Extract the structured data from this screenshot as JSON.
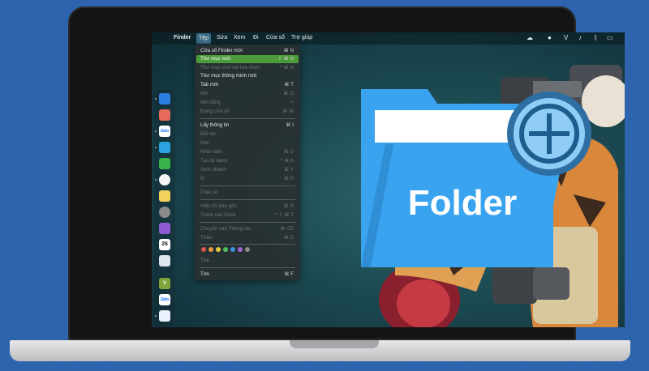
{
  "menubar": {
    "app": "Finder",
    "menus": [
      "Tệp",
      "Sửa",
      "Xem",
      "Đi",
      "Cửa sổ",
      "Trợ giúp"
    ]
  },
  "file_menu": {
    "items": [
      {
        "label": "Cửa sổ Finder mới",
        "shortcut": "⌘ N",
        "state": "normal"
      },
      {
        "label": "Thư mục mới",
        "shortcut": "⇧ ⌘ N",
        "state": "highlighted"
      },
      {
        "label": "Thư mục mới với lựa chọn",
        "shortcut": "^ ⌘ N",
        "state": "disabled"
      },
      {
        "label": "Thư mục thông minh mới",
        "shortcut": "",
        "state": "normal"
      },
      {
        "label": "Tab mới",
        "shortcut": "⌘ T",
        "state": "normal"
      },
      {
        "label": "Mở",
        "shortcut": "⌘ O",
        "state": "disabled"
      },
      {
        "label": "Mở bằng",
        "shortcut": ">",
        "state": "disabled"
      },
      {
        "label": "Đóng cửa sổ",
        "shortcut": "⌘ W",
        "state": "disabled"
      },
      {
        "label": "Lấy thông tin",
        "shortcut": "⌘ I",
        "state": "normal"
      },
      {
        "label": "Đổi tên",
        "shortcut": "",
        "state": "disabled"
      },
      {
        "label": "Nén",
        "shortcut": "",
        "state": "disabled"
      },
      {
        "label": "Nhân bản",
        "shortcut": "⌘ D",
        "state": "disabled"
      },
      {
        "label": "Tạo bí danh",
        "shortcut": "^ ⌘ A",
        "state": "disabled"
      },
      {
        "label": "Xem nhanh",
        "shortcut": "⌘ Y",
        "state": "disabled"
      },
      {
        "label": "In",
        "shortcut": "⌘ P",
        "state": "disabled"
      },
      {
        "label": "Chia sẻ",
        "shortcut": "",
        "state": "disabled"
      },
      {
        "label": "Hiển thị bản gốc",
        "shortcut": "⌘ R",
        "state": "disabled"
      },
      {
        "label": "Thêm vào Dock",
        "shortcut": "^ ⇧ ⌘ T",
        "state": "disabled"
      },
      {
        "label": "Chuyển vào Thùng rác",
        "shortcut": "⌘ ⌫",
        "state": "disabled"
      },
      {
        "label": "Tháo",
        "shortcut": "⌘ E",
        "state": "disabled"
      },
      {
        "label": "Thẻ...",
        "shortcut": "",
        "state": "disabled"
      },
      {
        "label": "Tìm",
        "shortcut": "⌘ F",
        "state": "normal"
      }
    ],
    "tag_colors": [
      "#e05252",
      "#e89a3c",
      "#e3c93b",
      "#4fbf5a",
      "#3f8fe0",
      "#a565d6",
      "#8d8d8d"
    ]
  },
  "dock": {
    "calendar_day": "26",
    "zalo_label": "Zalo",
    "v_label": "V"
  },
  "illustration": {
    "folder_text": "Folder",
    "colors": {
      "folder": "#3aa3f0",
      "plus_bg": "#8fcdf7",
      "plus_ring": "#2d6ea3"
    }
  }
}
